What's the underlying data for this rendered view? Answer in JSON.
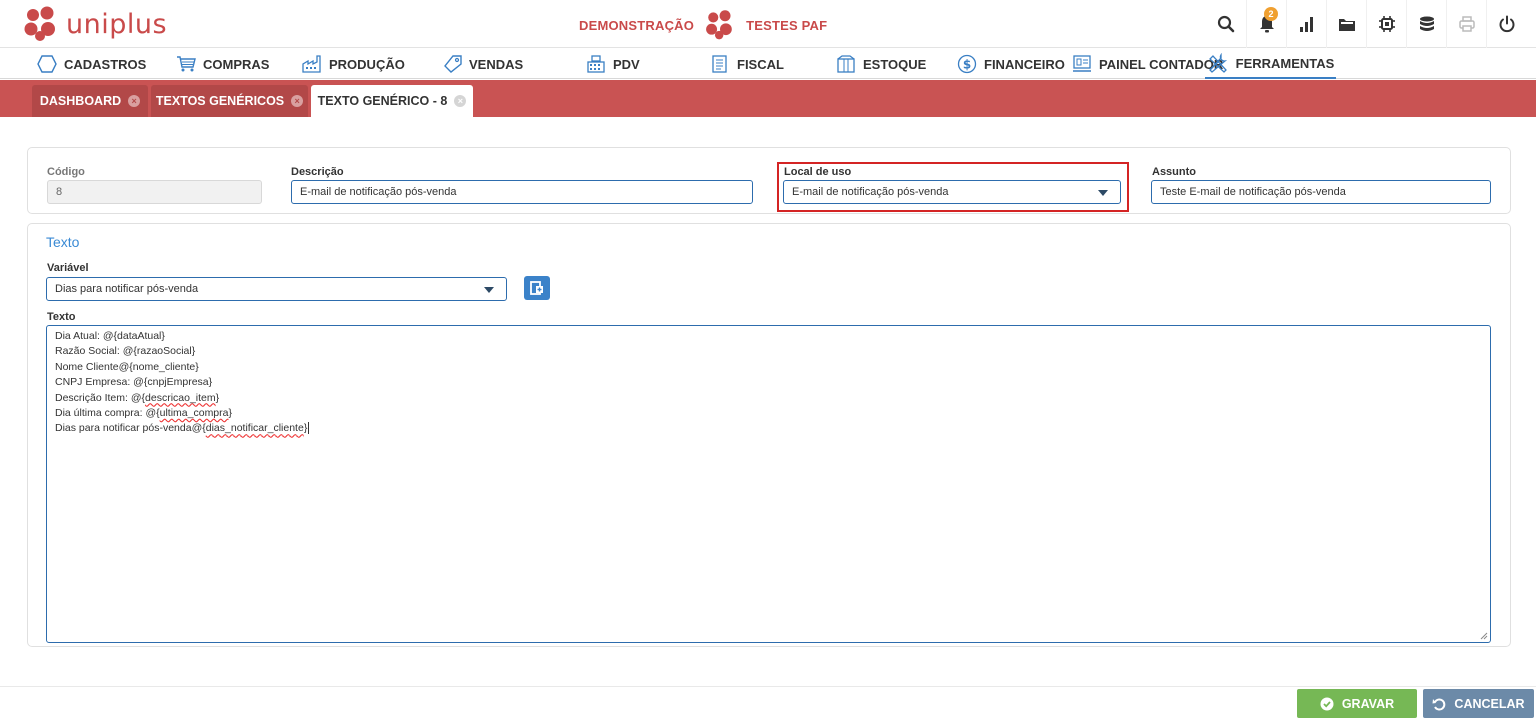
{
  "header": {
    "logo_text": "uniplus",
    "demo_label": "DEMONSTRAÇÃO",
    "env_label": "TESTES PAF",
    "notification_count": "2",
    "brand_color": "#c94a4a",
    "icons": [
      "search-icon",
      "bell-icon",
      "bar-chart-icon",
      "folder-icon",
      "chip-icon",
      "database-icon",
      "printer-icon",
      "power-icon"
    ]
  },
  "nav": {
    "items": [
      {
        "label": "CADASTROS",
        "icon": "hexagon-icon"
      },
      {
        "label": "COMPRAS",
        "icon": "cart-icon"
      },
      {
        "label": "PRODUÇÃO",
        "icon": "factory-icon"
      },
      {
        "label": "VENDAS",
        "icon": "tag-icon"
      },
      {
        "label": "PDV",
        "icon": "register-icon"
      },
      {
        "label": "FISCAL",
        "icon": "document-icon"
      },
      {
        "label": "ESTOQUE",
        "icon": "box-icon"
      },
      {
        "label": "FINANCEIRO",
        "icon": "dollar-icon"
      },
      {
        "label": "PAINEL CONTADOR",
        "icon": "panel-icon"
      },
      {
        "label": "FERRAMENTAS",
        "icon": "tools-icon"
      }
    ],
    "active": "FERRAMENTAS"
  },
  "tabs": [
    {
      "label": "DASHBOARD"
    },
    {
      "label": "TEXTOS GENÉRICOS"
    },
    {
      "label": "TEXTO GENÉRICO - 8"
    }
  ],
  "form": {
    "codigo_label": "Código",
    "codigo_value": "8",
    "descricao_label": "Descrição",
    "descricao_value": "E-mail de notificação pós-venda",
    "local_label": "Local de uso",
    "local_value": "E-mail de notificação pós-venda",
    "assunto_label": "Assunto",
    "assunto_value": "Teste E-mail de notificação pós-venda"
  },
  "texto_section": {
    "title": "Texto",
    "variavel_label": "Variável",
    "variavel_value": "Dias para notificar pós-venda",
    "texto_label": "Texto",
    "lines": [
      {
        "prefix": "Dia Atual: @{dataAtual}",
        "marked": ""
      },
      {
        "prefix": "Razão Social: @{razaoSocial}",
        "marked": ""
      },
      {
        "prefix": "Nome Cliente@{nome_cliente}",
        "marked": ""
      },
      {
        "prefix": "CNPJ Empresa: @{cnpjEmpresa}",
        "marked": ""
      },
      {
        "prefix": "Descrição Item: @{",
        "marked": "descricao_item",
        "suffix": "}"
      },
      {
        "prefix": "Dia última compra: @{",
        "marked": "ultima_compra",
        "suffix": "}"
      },
      {
        "prefix": "Dias para notificar pós-venda@{",
        "marked": "dias_notificar_cliente",
        "suffix": "}"
      }
    ]
  },
  "footer": {
    "save_label": "GRAVAR",
    "cancel_label": "CANCELAR"
  }
}
